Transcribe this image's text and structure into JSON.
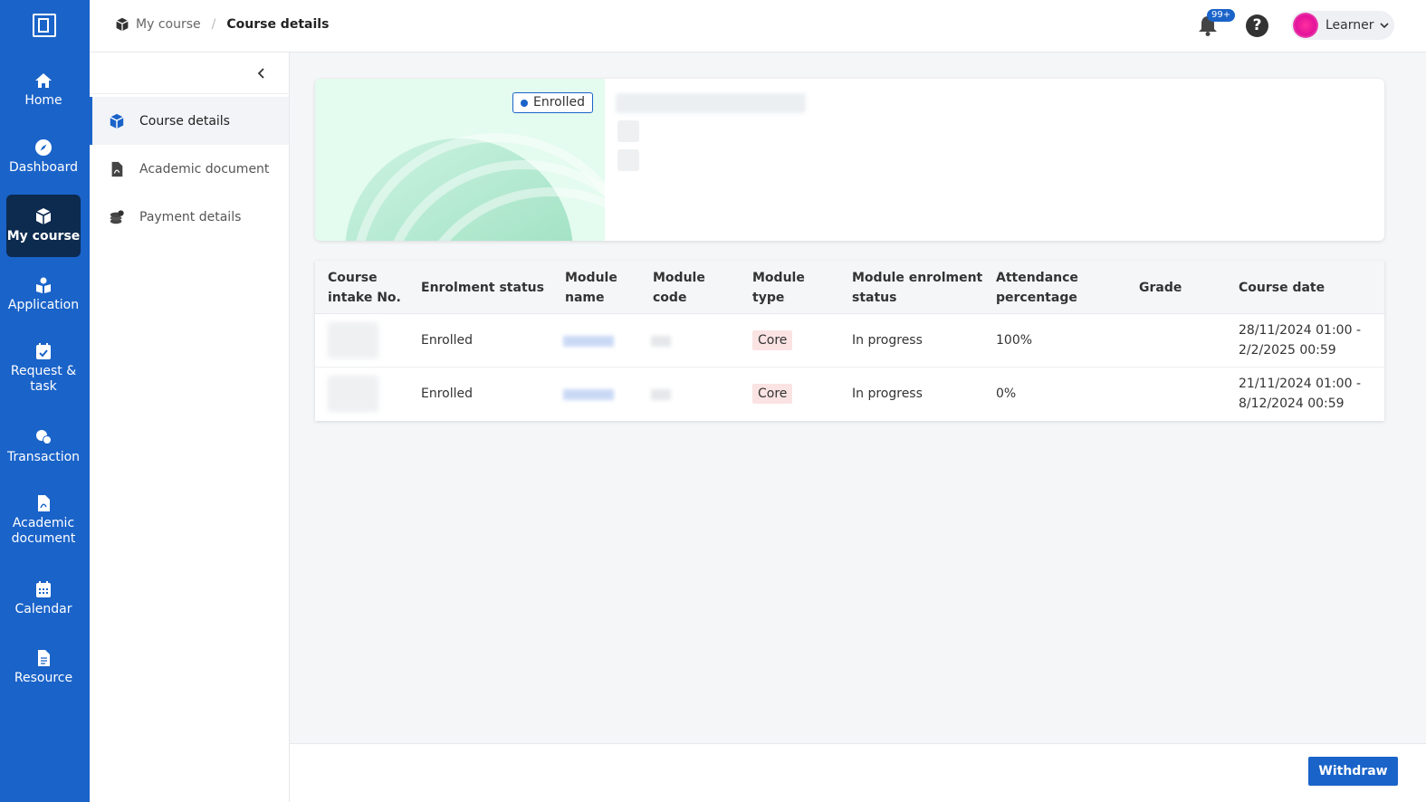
{
  "rail": {
    "items": [
      {
        "label": "Home"
      },
      {
        "label": "Dashboard"
      },
      {
        "label": "My course"
      },
      {
        "label": "Application"
      },
      {
        "label": "Request &\ntask"
      },
      {
        "label": "Transaction"
      },
      {
        "label": "Academic\ndocument"
      },
      {
        "label": "Calendar"
      },
      {
        "label": "Resource"
      }
    ],
    "active": "My course"
  },
  "header": {
    "breadcrumb": [
      "My course",
      "/",
      "Course details"
    ],
    "notification_badge": "99+",
    "user_name": "Learner",
    "help_glyph": "?"
  },
  "subnav": {
    "items": [
      {
        "label": "Course details",
        "icon": "cube-icon"
      },
      {
        "label": "Academic document",
        "icon": "pdf-file-icon"
      },
      {
        "label": "Payment details",
        "icon": "coins-icon"
      }
    ],
    "active": "Course details"
  },
  "hero": {
    "status": "Enrolled"
  },
  "table": {
    "headers": [
      "Course\nintake No.",
      "Enrolment status",
      "Module\nname",
      "Module\ncode",
      "Module\ntype",
      "Module enrolment\nstatus",
      "Attendance\npercentage",
      "Grade",
      "Course date"
    ],
    "rows": [
      {
        "enrolment_status": "Enrolled",
        "module_type": "Core",
        "module_enrolment_status": "In progress",
        "attendance": "100%",
        "grade": "",
        "course_date": "28/11/2024 01:00 -\n2/2/2025 00:59"
      },
      {
        "enrolment_status": "Enrolled",
        "module_type": "Core",
        "module_enrolment_status": "In progress",
        "attendance": "0%",
        "grade": "",
        "course_date": "21/11/2024 01:00 -\n8/12/2024 00:59"
      }
    ]
  },
  "footer": {
    "withdraw_label": "Withdraw"
  },
  "colors": {
    "primary": "#1a63c9",
    "rail_active": "#0d2a4f",
    "hero_bg": "#e4fbef",
    "core_tag": "#fbe3e3"
  }
}
